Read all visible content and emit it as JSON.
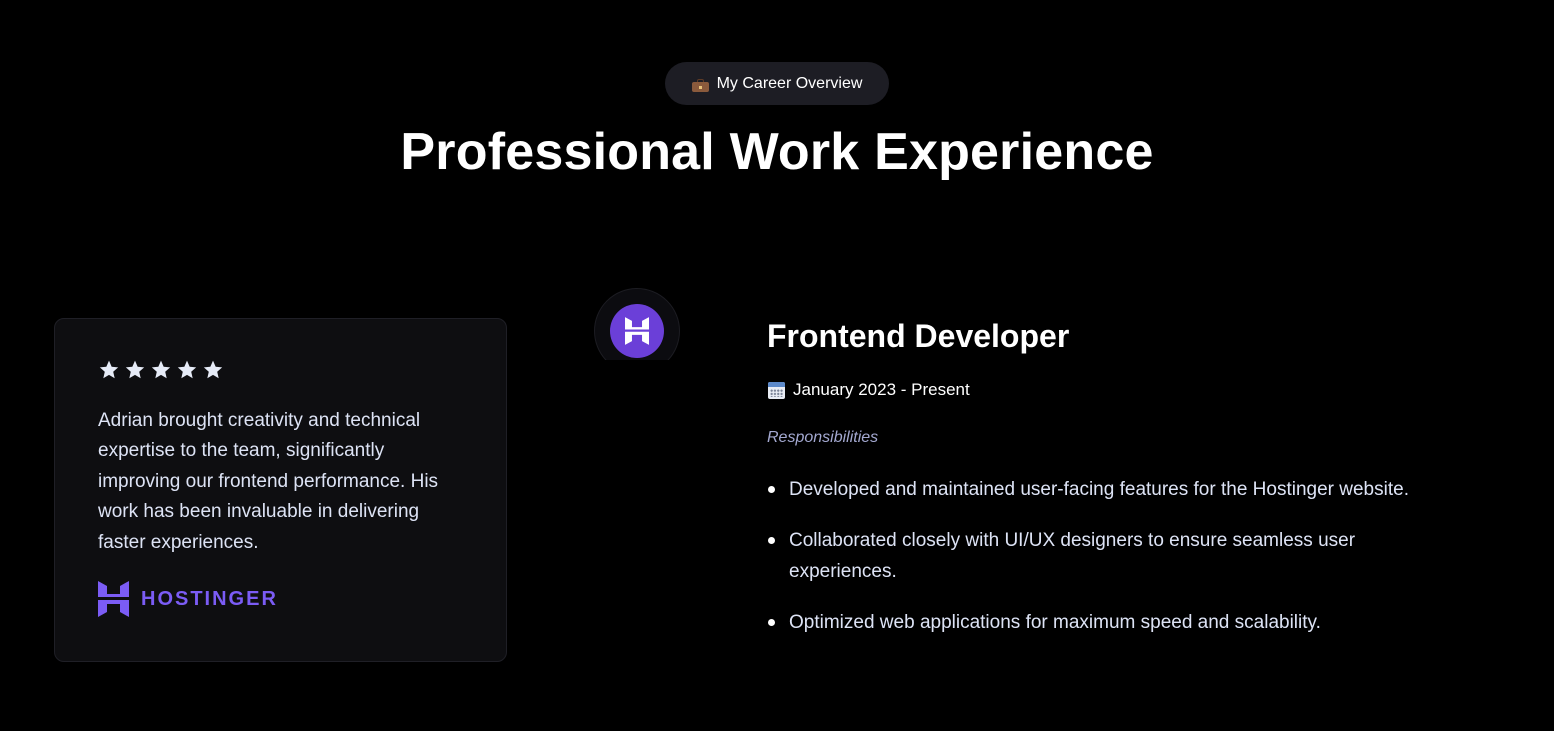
{
  "header": {
    "badge_icon": "briefcase-icon",
    "badge_label": "My Career Overview",
    "title": "Professional Work Experience"
  },
  "testimonial": {
    "rating": 5,
    "rating_max": 5,
    "quote": "Adrian brought creativity and technical expertise to the team, significantly improving our frontend performance. His work has been invaluable in delivering faster experiences.",
    "company_logo_icon": "hostinger-logo-icon",
    "company_name": "HOSTINGER"
  },
  "experience": {
    "icon": "hostinger-icon",
    "job_title": "Frontend Developer",
    "date_icon": "calendar-icon",
    "date_range": "January 2023 - Present",
    "responsibilities_label": "Responsibilities",
    "responsibilities": [
      "Developed and maintained user-facing features for the Hostinger website.",
      "Collaborated closely with UI/UX designers to ensure seamless user experiences.",
      "Optimized web applications for maximum speed and scalability."
    ]
  },
  "colors": {
    "background": "#000000",
    "card_background": "#0e0e11",
    "accent_purple": "#7b5cf5",
    "icon_circle": "#6b3fd8",
    "badge_background": "#1d1d24",
    "muted_text": "#a3a8d0",
    "body_text": "#dde3f5"
  }
}
